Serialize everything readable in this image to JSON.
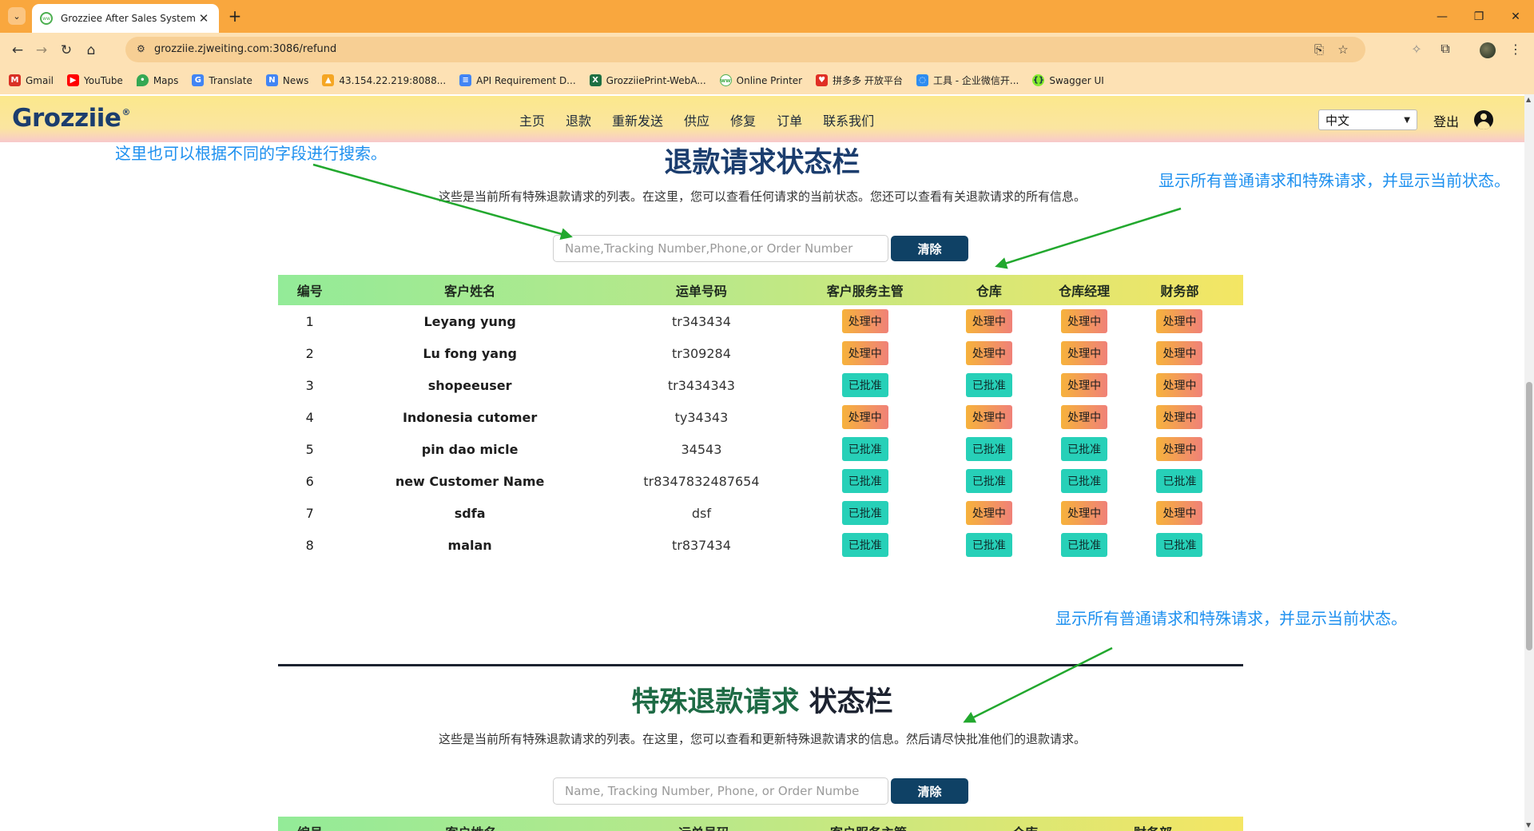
{
  "browser": {
    "tab_title": "Grozziee After Sales System",
    "url": "grozziie.zjweiting.com:3086/refund",
    "bookmarks": [
      {
        "label": "Gmail",
        "icon": "gmail-icon",
        "color": "#d93025"
      },
      {
        "label": "YouTube",
        "icon": "youtube-icon",
        "color": "#ff0000"
      },
      {
        "label": "Maps",
        "icon": "maps-pin-icon",
        "color": "#34a853"
      },
      {
        "label": "Translate",
        "icon": "translate-icon",
        "color": "#4285f4"
      },
      {
        "label": "News",
        "icon": "news-icon",
        "color": "#4285f4"
      },
      {
        "label": "43.154.22.219:8088...",
        "icon": "chart-icon",
        "color": "#f5a623"
      },
      {
        "label": "API Requirement D...",
        "icon": "doc-icon",
        "color": "#4285f4"
      },
      {
        "label": "GrozziiePrint-WebA...",
        "icon": "excel-icon",
        "color": "#1d6f42"
      },
      {
        "label": "Online Printer",
        "icon": "printer-site-icon",
        "color": "#4caf50"
      },
      {
        "label": "拼多多 开放平台",
        "icon": "pinduoduo-icon",
        "color": "#e02e24"
      },
      {
        "label": "工具 - 企业微信开...",
        "icon": "wecom-icon",
        "color": "#2d8cf0"
      },
      {
        "label": "Swagger UI",
        "icon": "swagger-icon",
        "color": "#85ea2d"
      }
    ]
  },
  "site": {
    "logo": "Grozziie",
    "logo_mark": "®",
    "nav": [
      "主页",
      "退款",
      "重新发送",
      "供应",
      "修复",
      "订单",
      "联系我们"
    ],
    "language": "中文",
    "logout": "登出"
  },
  "section1": {
    "title": "退款请求状态栏",
    "description": "这些是当前所有特殊退款请求的列表。在这里，您可以查看任何请求的当前状态。您还可以查看有关退款请求的所有信息。",
    "search_placeholder": "Name,Tracking Number,Phone,or Order Number",
    "clear_label": "清除"
  },
  "table": {
    "headers": [
      "编号",
      "客户姓名",
      "运单号码",
      "客户服务主管",
      "仓库",
      "仓库经理",
      "财务部"
    ],
    "rows": [
      {
        "no": "1",
        "name": "Leyang yung",
        "tracking": "tr343434",
        "status": [
          "处理中",
          "处理中",
          "处理中",
          "处理中"
        ]
      },
      {
        "no": "2",
        "name": "Lu fong yang",
        "tracking": "tr309284",
        "status": [
          "处理中",
          "处理中",
          "处理中",
          "处理中"
        ]
      },
      {
        "no": "3",
        "name": "shopeeuser",
        "tracking": "tr3434343",
        "status": [
          "已批准",
          "已批准",
          "处理中",
          "处理中"
        ]
      },
      {
        "no": "4",
        "name": "Indonesia cutomer",
        "tracking": "ty34343",
        "status": [
          "处理中",
          "处理中",
          "处理中",
          "处理中"
        ]
      },
      {
        "no": "5",
        "name": "pin dao micle",
        "tracking": "34543",
        "status": [
          "已批准",
          "已批准",
          "已批准",
          "处理中"
        ]
      },
      {
        "no": "6",
        "name": "new Customer Name",
        "tracking": "tr8347832487654",
        "status": [
          "已批准",
          "已批准",
          "已批准",
          "已批准"
        ]
      },
      {
        "no": "7",
        "name": "sdfa",
        "tracking": "dsf",
        "status": [
          "已批准",
          "处理中",
          "处理中",
          "处理中"
        ]
      },
      {
        "no": "8",
        "name": "malan",
        "tracking": "tr837434",
        "status": [
          "已批准",
          "已批准",
          "已批准",
          "已批准"
        ]
      }
    ]
  },
  "section2": {
    "title_green": "特殊退款请求",
    "title_dark": "状态栏",
    "description": "这些是当前所有特殊退款请求的列表。在这里，您可以查看和更新特殊退款请求的信息。然后请尽快批准他们的退款请求。",
    "search_placeholder": "Name, Tracking Number, Phone, or Order Numbe",
    "clear_label": "清除",
    "headers": [
      "编号",
      "客户姓名",
      "运单号码",
      "客户服务主管",
      "仓库",
      "财务部"
    ]
  },
  "annotations": {
    "search_note": "这里也可以根据不同的字段进行搜索。",
    "table_note": "显示所有普通请求和特殊请求，并显示当前状态。",
    "special_note": "显示所有普通请求和特殊请求，并显示当前状态。"
  },
  "colors": {
    "accent_navy": "#0f4165",
    "annotation_blue": "#1e90ef",
    "arrow_green": "#22a82e",
    "approved": "#27d0b8",
    "pending_from": "#f6b23c",
    "pending_to": "#f08178"
  }
}
